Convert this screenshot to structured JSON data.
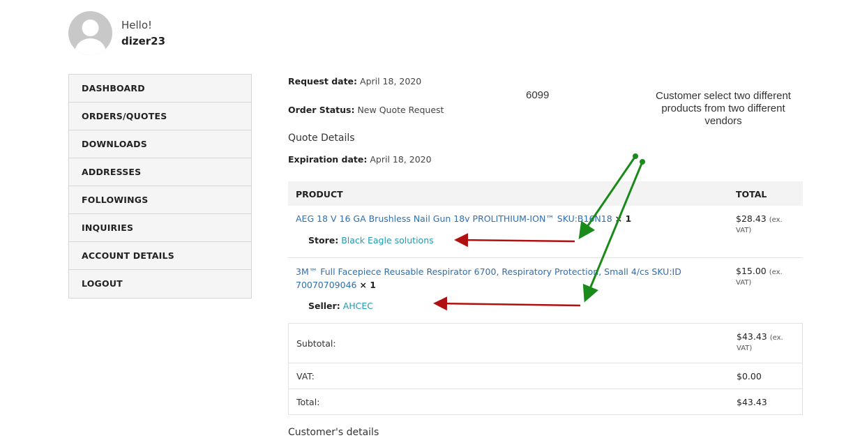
{
  "user": {
    "greeting": "Hello!",
    "username": "dizer23",
    "avatar_icon": "user-avatar-icon"
  },
  "nav": {
    "items": [
      {
        "label": "DASHBOARD"
      },
      {
        "label": "ORDERS/QUOTES"
      },
      {
        "label": "DOWNLOADS"
      },
      {
        "label": "ADDRESSES"
      },
      {
        "label": "FOLLOWINGS"
      },
      {
        "label": "INQUIRIES"
      },
      {
        "label": "ACCOUNT DETAILS"
      },
      {
        "label": "LOGOUT"
      }
    ]
  },
  "quote": {
    "request_date_label": "Request date",
    "request_date": "April 18, 2020",
    "status_label": "Order Status:",
    "status": "New Quote Request",
    "details_heading": "Quote Details",
    "expiration_label": "Expiration date",
    "expiration_date": "April 18, 2020"
  },
  "annotation": {
    "number": "6099",
    "note": "Customer select two different products from two different vendors",
    "green_arrow_color": "#1a8a1a",
    "red_arrow_color": "#b01010"
  },
  "table": {
    "col_product": "PRODUCT",
    "col_total": "TOTAL",
    "items": [
      {
        "name": "AEG 18 V 16 GA Brushless Nail Gun 18v PROLITHIUM-ION™ SKU:B16N18",
        "qty": "× 1",
        "vendor_label": "Store:",
        "vendor": "Black Eagle solutions",
        "price": "$28.43",
        "price_note": "(ex.",
        "price_note2": "VAT)"
      },
      {
        "name_line1": "3M™ Full Facepiece Reusable Respirator 6700, Respiratory Protection, Small 4/cs SKU:ID",
        "name_line2": "70070709046",
        "qty": "× 1",
        "vendor_label": "Seller:",
        "vendor": "AHCEC",
        "price": "$15.00",
        "price_note": "(ex.",
        "price_note2": "VAT)"
      }
    ],
    "subtotal_label": "Subtotal:",
    "subtotal": "$43.43",
    "subtotal_note": "(ex.",
    "subtotal_note2": "VAT)",
    "vat_label": "VAT:",
    "vat": "$0.00",
    "total_label": "Total:",
    "total": "$43.43"
  },
  "customer_details_heading": "Customer's details"
}
